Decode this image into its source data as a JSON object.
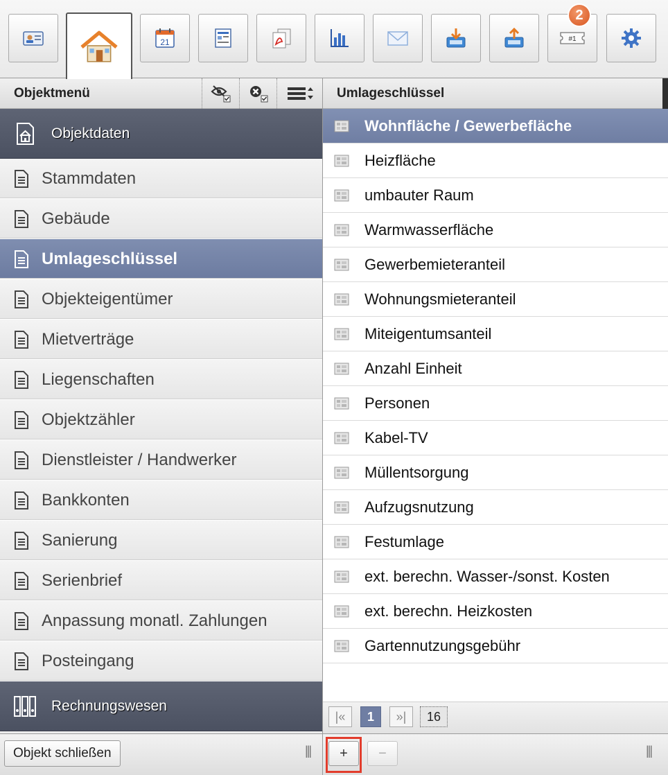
{
  "toolbar": {
    "buttons": [
      {
        "name": "contact-card-icon"
      },
      {
        "name": "home-icon",
        "active": true
      },
      {
        "name": "calendar-icon",
        "day": "21"
      },
      {
        "name": "form-icon"
      },
      {
        "name": "pdf-icon"
      },
      {
        "name": "bar-chart-icon"
      },
      {
        "name": "mail-icon"
      },
      {
        "name": "import-icon"
      },
      {
        "name": "export-icon"
      },
      {
        "name": "ticket-icon",
        "label": "#1",
        "badge": "2"
      },
      {
        "name": "gear-icon"
      }
    ]
  },
  "left_panel": {
    "title": "Objektmenü",
    "sections": {
      "objektdaten": "Objektdaten",
      "rechnungswesen": "Rechnungswesen"
    },
    "items": [
      "Stammdaten",
      "Gebäude",
      "Umlageschlüssel",
      "Objekteigentümer",
      "Mietverträge",
      "Liegenschaften",
      "Objektzähler",
      "Dienstleister / Handwerker",
      "Bankkonten",
      "Sanierung",
      "Serienbrief",
      "Anpassung monatl. Zahlungen",
      "Posteingang"
    ],
    "selected_index": 2,
    "close_button": "Objekt schließen",
    "grip": "|||"
  },
  "right_panel": {
    "title": "Umlageschlüssel",
    "rows": [
      "Wohnfläche / Gewerbefläche",
      "Heizfläche",
      "umbauter Raum",
      "Warmwasserfläche",
      "Gewerbemieteranteil",
      "Wohnungsmieteranteil",
      "Miteigentumsanteil",
      "Anzahl Einheit",
      "Personen",
      "Kabel-TV",
      "Müllentsorgung",
      "Aufzugsnutzung",
      "Festumlage",
      "ext. berechn. Wasser-/sonst. Kosten",
      "ext. berechn. Heizkosten",
      "Gartennutzungsgebühr"
    ],
    "selected_index": 0,
    "pager": {
      "first": "|«",
      "current": "1",
      "last": "»|",
      "total": "16"
    },
    "add_label": "+",
    "remove_label": "−",
    "grip": "|||"
  },
  "colors": {
    "section_bg": "#4b5161",
    "selected_bg": "#6f7ea3",
    "badge": "#d8551f",
    "highlight": "#e23c2c"
  }
}
